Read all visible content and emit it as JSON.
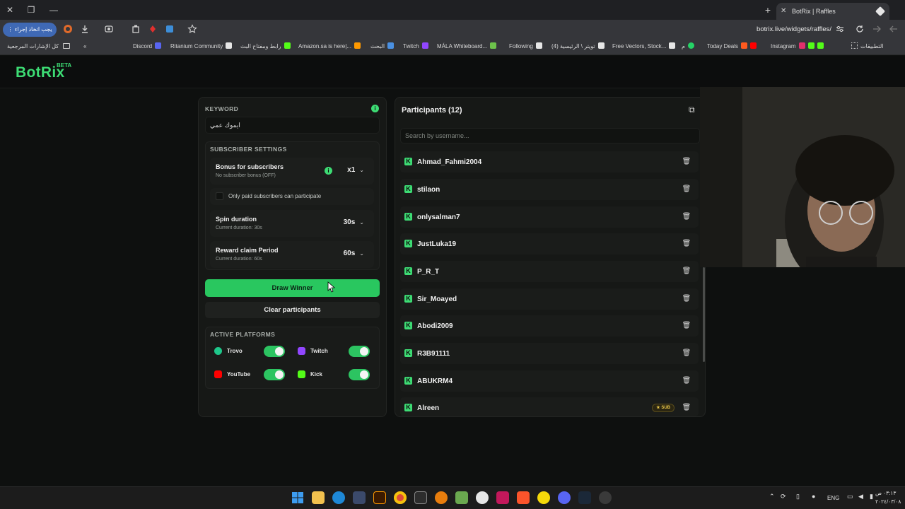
{
  "browser": {
    "tab_title": "BotRix | Raffles",
    "new_tab": "+",
    "tab_close": "✕",
    "window_close": "✕",
    "window_restore": "❐",
    "window_minimize": "—",
    "action_button": "⋮ يجب اتخاذ إجراء",
    "url": "botrix.live/widgets/raffles/",
    "bookmarks_all": "كل الإشارات المرجعية",
    "bookmarks_chevron": "«",
    "bookmarks": [
      {
        "label": "Discord",
        "color": "#5865f2"
      },
      {
        "label": "Ritanium Community",
        "color": "#e6e6e6"
      },
      {
        "label": "رابط ومفتاح البث",
        "color": "#53fc18"
      },
      {
        "label": "Amazon.sa is here|...",
        "color": "#ff9900"
      },
      {
        "label": "البحث",
        "color": "#4a90e2"
      },
      {
        "label": "Twitch",
        "color": "#9146ff"
      },
      {
        "label": "MÁLA Whiteboard...",
        "color": "#6dc24b"
      },
      {
        "label": "Following",
        "color": "#e6e6e6"
      },
      {
        "label": "(4) تويتر \\ الرئيسية",
        "color": "#e6e6e6"
      },
      {
        "label": "Free Vectors, Stock...",
        "color": "#e6e6e6"
      },
      {
        "label": "م",
        "color": "#25d366"
      },
      {
        "label": "Today Deals",
        "color": "#ff0000"
      },
      {
        "label": "Instagram",
        "color": "#e1306c"
      },
      {
        "label": "التطبيقات",
        "color": "#cfcfcf"
      }
    ]
  },
  "logo": {
    "name": "BotRix",
    "badge": "BETA"
  },
  "settings": {
    "keyword_label": "KEYWORD",
    "keyword_value": "ايموك عمي",
    "info_glyph": "i",
    "subscriber_settings_label": "SUBSCRIBER SETTINGS",
    "bonus_title": "Bonus for subscribers",
    "bonus_sub": "No subscriber bonus (OFF)",
    "bonus_value": "x1",
    "paid_only_label": "Only paid subscribers can participate",
    "spin_title": "Spin duration",
    "spin_sub": "Current duration: 30s",
    "spin_value": "30s",
    "reward_title": "Reward claim Period",
    "reward_sub": "Current duration: 60s",
    "reward_value": "60s",
    "chevron": "⌄",
    "draw_winner": "Draw Winner",
    "clear_participants": "Clear participants",
    "active_platforms_label": "ACTIVE PLATFORMS",
    "platforms": [
      {
        "name": "Trovo",
        "color": "#1ec78a",
        "enabled": true
      },
      {
        "name": "Twitch",
        "color": "#9146ff",
        "enabled": true
      },
      {
        "name": "YouTube",
        "color": "#ff0000",
        "enabled": true
      },
      {
        "name": "Kick",
        "color": "#53fc18",
        "enabled": true
      }
    ]
  },
  "participants": {
    "title": "Participants (12)",
    "search_placeholder": "Search by username...",
    "copy_glyph": "⧉",
    "delete_glyph": "🗑",
    "kick_glyph": "K",
    "sub_badge": "★ SUB",
    "list": [
      {
        "name": "Ahmad_Fahmi2004"
      },
      {
        "name": "stilaon"
      },
      {
        "name": "onlysalman7"
      },
      {
        "name": "JustLuka19"
      },
      {
        "name": "P_R_T"
      },
      {
        "name": "Sir_Moayed"
      },
      {
        "name": "Abodi2009"
      },
      {
        "name": "R3B91111"
      },
      {
        "name": "ABUKRM4"
      },
      {
        "name": "Alreen"
      }
    ]
  },
  "taskbar": {
    "lang": "ENG",
    "time": "٠٣:١٣ ص",
    "date": "٢٠٢٤/٠٣/٠٨"
  }
}
